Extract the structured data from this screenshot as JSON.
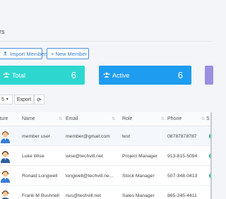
{
  "page": {
    "title_fragment": "ers"
  },
  "actions": {
    "import_label": "Import Members",
    "new_label": "+ New Member",
    "import_icon": "upload-icon"
  },
  "stats": {
    "total": {
      "label": "Total",
      "value": "6",
      "color": "#2dd7cf",
      "icon": "users-icon"
    },
    "active": {
      "label": "Active",
      "value": "6",
      "color": "#1e9cf0",
      "icon": "users-icon"
    },
    "third": {
      "color": "#9b8fe0"
    }
  },
  "toolbar": {
    "page_size": "5",
    "export_label": "Export",
    "refresh_icon": "refresh-icon"
  },
  "table": {
    "columns": [
      "cture",
      "Name",
      "Email",
      "Role",
      "Phone",
      "S"
    ],
    "rows": [
      {
        "name": "member user",
        "email": "member@gmail.com",
        "role": "test",
        "phone": "08787878787"
      },
      {
        "name": "Luke Wise",
        "email": "wise@techvill.net",
        "role": "Project Manager",
        "phone": "913-815-5094"
      },
      {
        "name": "Ronald Longwell",
        "email": "longwell@techvill.ne...",
        "role": "Stock Manager",
        "phone": "507-348-0413"
      },
      {
        "name": "Frank M Bushnell",
        "email": "nus@techvill.net",
        "role": "Sales Manager",
        "phone": "865-245-4411"
      }
    ],
    "status_color": "#1abc9c"
  }
}
